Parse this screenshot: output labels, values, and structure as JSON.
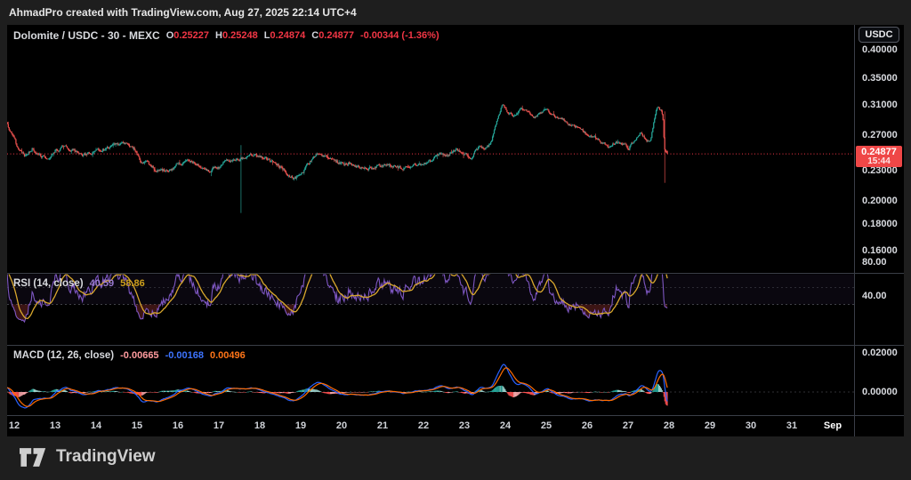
{
  "attribution_bar": {
    "text": "AhmadPro created with TradingView.com, Aug 27, 2025 22:14 UTC+4"
  },
  "symbol_legend": {
    "title": "Dolomite / USDC - 30 - MEXC",
    "ohlc": [
      {
        "label": "O",
        "value": "0.25227"
      },
      {
        "label": "H",
        "value": "0.25248"
      },
      {
        "label": "L",
        "value": "0.24874"
      },
      {
        "label": "C",
        "value": "0.24877"
      }
    ],
    "change": "-0.00344 (-1.36%)"
  },
  "price_axis": {
    "currency_button": "USDC",
    "labels": [
      {
        "text": "0.40000",
        "value": 0.4
      },
      {
        "text": "0.35000",
        "value": 0.35
      },
      {
        "text": "0.31000",
        "value": 0.31
      },
      {
        "text": "0.27000",
        "value": 0.27
      },
      {
        "text": "0.23000",
        "value": 0.23
      },
      {
        "text": "0.20000",
        "value": 0.2
      },
      {
        "text": "0.18000",
        "value": 0.18
      },
      {
        "text": "0.16000",
        "value": 0.16
      }
    ],
    "last_price": {
      "text": "0.24877",
      "value": 0.24877,
      "countdown": "15:44",
      "color": "#ef4747"
    }
  },
  "time_axis": {
    "labels": [
      {
        "text": "12",
        "day": 12
      },
      {
        "text": "13",
        "day": 13
      },
      {
        "text": "14",
        "day": 14
      },
      {
        "text": "15",
        "day": 15
      },
      {
        "text": "16",
        "day": 16
      },
      {
        "text": "17",
        "day": 17
      },
      {
        "text": "18",
        "day": 18
      },
      {
        "text": "19",
        "day": 19
      },
      {
        "text": "20",
        "day": 20
      },
      {
        "text": "21",
        "day": 21
      },
      {
        "text": "22",
        "day": 22
      },
      {
        "text": "23",
        "day": 23
      },
      {
        "text": "24",
        "day": 24
      },
      {
        "text": "25",
        "day": 25
      },
      {
        "text": "26",
        "day": 26
      },
      {
        "text": "27",
        "day": 27
      },
      {
        "text": "28",
        "day": 28
      },
      {
        "text": "29",
        "day": 29
      },
      {
        "text": "30",
        "day": 30
      },
      {
        "text": "31",
        "day": 31
      },
      {
        "text": "Sep",
        "day": 32,
        "bold": true
      }
    ]
  },
  "rsi_panel": {
    "legend": {
      "title": "RSI (14, close)",
      "value1": "40.59",
      "value2": "58.86"
    },
    "axis_labels": [
      {
        "text": "80.00",
        "value": 80
      },
      {
        "text": "40.00",
        "value": 40
      }
    ],
    "band_levels": [
      70,
      50,
      30
    ]
  },
  "macd_panel": {
    "legend": {
      "title": "MACD (12, 26, close)",
      "hist": "-0.00665",
      "macd": "-0.00168",
      "signal": "0.00496"
    },
    "axis_labels": [
      {
        "text": "0.02000",
        "value": 0.02
      },
      {
        "text": "0.00000",
        "value": 0
      }
    ]
  },
  "footer": {
    "brand": "TradingView"
  },
  "chart_data": {
    "type": "candlestick",
    "symbol": "Dolomite / USDC",
    "interval_minutes": 30,
    "exchange": "MEXC",
    "price_scale": "log",
    "x_unit": "day of August 2025",
    "x_visible_range": [
      11.83,
      32.3
    ],
    "candle_interval_days": 0.0208333,
    "ohlc_current": {
      "open": 0.25227,
      "high": 0.25248,
      "low": 0.24874,
      "close": 0.24877,
      "change": -0.00344,
      "change_pct": -1.36
    },
    "price_anchors": [
      [
        11.0,
        0.272
      ],
      [
        11.4,
        0.28
      ],
      [
        11.83,
        0.286
      ],
      [
        11.9,
        0.277
      ],
      [
        12.0,
        0.266
      ],
      [
        12.1,
        0.252
      ],
      [
        12.25,
        0.246
      ],
      [
        12.45,
        0.256
      ],
      [
        12.6,
        0.247
      ],
      [
        12.8,
        0.244
      ],
      [
        13.0,
        0.253
      ],
      [
        13.25,
        0.259
      ],
      [
        13.5,
        0.252
      ],
      [
        13.75,
        0.248
      ],
      [
        14.0,
        0.253
      ],
      [
        14.4,
        0.258
      ],
      [
        14.75,
        0.261
      ],
      [
        14.95,
        0.252
      ],
      [
        15.1,
        0.24
      ],
      [
        15.35,
        0.235
      ],
      [
        15.6,
        0.229
      ],
      [
        15.8,
        0.232
      ],
      [
        16.0,
        0.238
      ],
      [
        16.25,
        0.242
      ],
      [
        16.5,
        0.236
      ],
      [
        16.75,
        0.231
      ],
      [
        17.0,
        0.235
      ],
      [
        17.25,
        0.242
      ],
      [
        17.5,
        0.24
      ],
      [
        17.65,
        0.245
      ],
      [
        17.8,
        0.248
      ],
      [
        18.1,
        0.244
      ],
      [
        18.4,
        0.238
      ],
      [
        18.65,
        0.229
      ],
      [
        18.85,
        0.222
      ],
      [
        19.05,
        0.228
      ],
      [
        19.3,
        0.245
      ],
      [
        19.5,
        0.249
      ],
      [
        19.75,
        0.243
      ],
      [
        19.95,
        0.238
      ],
      [
        20.2,
        0.24
      ],
      [
        20.5,
        0.234
      ],
      [
        20.8,
        0.233
      ],
      [
        21.1,
        0.236
      ],
      [
        21.4,
        0.233
      ],
      [
        21.7,
        0.235
      ],
      [
        21.95,
        0.237
      ],
      [
        22.2,
        0.242
      ],
      [
        22.4,
        0.25
      ],
      [
        22.6,
        0.247
      ],
      [
        22.8,
        0.253
      ],
      [
        23.0,
        0.248
      ],
      [
        23.2,
        0.246
      ],
      [
        23.35,
        0.258
      ],
      [
        23.5,
        0.253
      ],
      [
        23.65,
        0.262
      ],
      [
        23.8,
        0.29
      ],
      [
        23.92,
        0.311
      ],
      [
        24.05,
        0.302
      ],
      [
        24.2,
        0.295
      ],
      [
        24.35,
        0.307
      ],
      [
        24.55,
        0.301
      ],
      [
        24.7,
        0.296
      ],
      [
        24.85,
        0.301
      ],
      [
        25.0,
        0.302
      ],
      [
        25.2,
        0.294
      ],
      [
        25.4,
        0.291
      ],
      [
        25.6,
        0.284
      ],
      [
        25.8,
        0.28
      ],
      [
        26.0,
        0.272
      ],
      [
        26.2,
        0.266
      ],
      [
        26.4,
        0.261
      ],
      [
        26.55,
        0.258
      ],
      [
        26.7,
        0.263
      ],
      [
        26.85,
        0.259
      ],
      [
        27.0,
        0.256
      ],
      [
        27.15,
        0.263
      ],
      [
        27.3,
        0.272
      ],
      [
        27.45,
        0.264
      ],
      [
        27.55,
        0.266
      ],
      [
        27.65,
        0.295
      ],
      [
        27.72,
        0.31
      ],
      [
        27.8,
        0.303
      ],
      [
        27.85,
        0.294
      ],
      [
        27.89,
        0.252
      ],
      [
        27.958,
        0.24877
      ]
    ],
    "wick_events": [
      {
        "day": 17.55,
        "high": 0.259,
        "low": 0.19
      },
      {
        "day": 27.89,
        "high": 0.302,
        "low": 0.218
      }
    ],
    "indicators": [
      {
        "type": "RSI",
        "length": 14,
        "source": "close",
        "current_values": [
          40.59,
          58.86
        ],
        "bands": [
          70,
          50,
          30
        ]
      },
      {
        "type": "MACD",
        "fast": 12,
        "slow": 26,
        "signal_len": 9,
        "source": "close",
        "current_hist": -0.00665,
        "current_macd": -0.00168,
        "current_signal": 0.00496
      }
    ],
    "colors": {
      "up": "#26a69a",
      "down": "#ef5350",
      "rsi": "#7e57c2",
      "rsi_ma": "#d9a82d",
      "rsi_band_fill": "rgba(126,87,194,0.08)",
      "overbought_fill": "rgba(38,166,154,0.30)",
      "oversold_fill": "rgba(239,83,80,0.25)",
      "macd_line": "#2962ff",
      "signal_line": "#ff6d00",
      "hist_up": "#26a69a",
      "hist_up_weak": "#9bd0ca",
      "hist_down": "#ff5252",
      "hist_down_weak": "#f3a5a8",
      "last_price_line": "#f23645",
      "separator": "#3a3e47",
      "dashed_band": "rgba(165,169,182,0.55)"
    }
  }
}
